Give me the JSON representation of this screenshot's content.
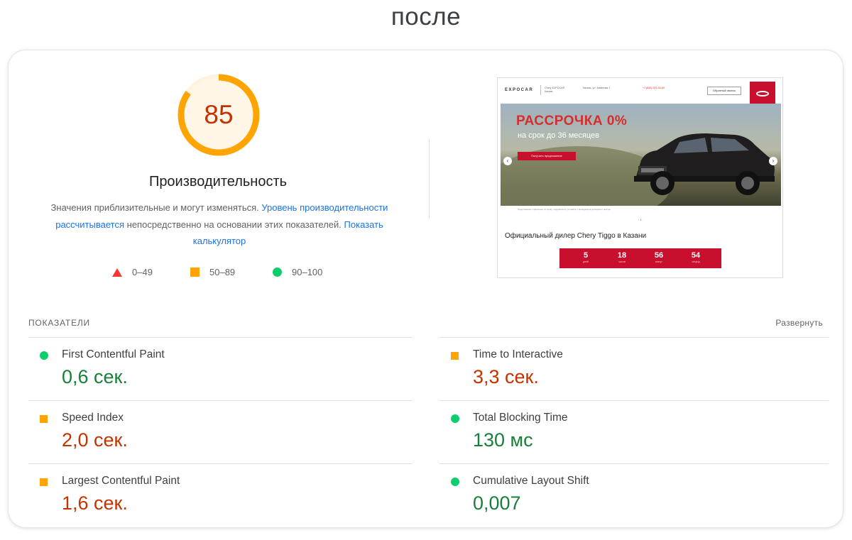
{
  "page": {
    "heading": "после"
  },
  "summary": {
    "score": "85",
    "score_fraction": 0.85,
    "title": "Производительность",
    "description": {
      "part1": "Значения приблизительные и могут изменяться.",
      "link1": "Уровень производительности рассчитывается",
      "part2": "непосредственно на основании этих показателей.",
      "link2": "Показать калькулятор"
    },
    "legend": [
      {
        "shape": "triangle",
        "label": "0–49",
        "color": "#ff3333"
      },
      {
        "shape": "square",
        "label": "50–89",
        "color": "#ffa400"
      },
      {
        "shape": "circle",
        "label": "90–100",
        "color": "#0cce6b"
      }
    ],
    "gauge_color": "#ffa400",
    "gauge_track_color": "#fff3e0"
  },
  "thumbnail": {
    "brand": "EXPOCAR",
    "header_small": "Chery EXPOCAR Казань",
    "header_address": "Казань, ул. Ахметова 7",
    "header_phone": "+7 (843) 203-30-69",
    "header_button": "Обратный звонок",
    "promo": "РАССРОЧКА 0%",
    "promo_sub": "на срок до 36 месяцев",
    "cta": "Получить предложение",
    "fine_print": "Предложение ограничено по сроку, подробности уточняйте у менеджеров дилерского центра.",
    "pager": "◦ 1",
    "dealer_text": "Официальный дилер Chery Tiggo в Казани",
    "timer": [
      {
        "num": "5",
        "label": "дней"
      },
      {
        "num": "18",
        "label": "часов"
      },
      {
        "num": "56",
        "label": "минут"
      },
      {
        "num": "54",
        "label": "секунд"
      }
    ]
  },
  "metrics": {
    "title": "ПОКАЗАТЕЛИ",
    "expand": "Развернуть",
    "items": [
      {
        "name": "First Contentful Paint",
        "value": "0,6 сек.",
        "status": "good"
      },
      {
        "name": "Time to Interactive",
        "value": "3,3 сек.",
        "status": "average"
      },
      {
        "name": "Speed Index",
        "value": "2,0 сек.",
        "status": "average"
      },
      {
        "name": "Total Blocking Time",
        "value": "130 мс",
        "status": "good"
      },
      {
        "name": "Largest Contentful Paint",
        "value": "1,6 сек.",
        "status": "average"
      },
      {
        "name": "Cumulative Layout Shift",
        "value": "0,007",
        "status": "good"
      }
    ]
  },
  "colors": {
    "good": "#0cce6b",
    "average": "#ffa400",
    "poor": "#ff3333",
    "value_good": "#188038",
    "value_average": "#c33300",
    "link": "#1a73e8"
  }
}
